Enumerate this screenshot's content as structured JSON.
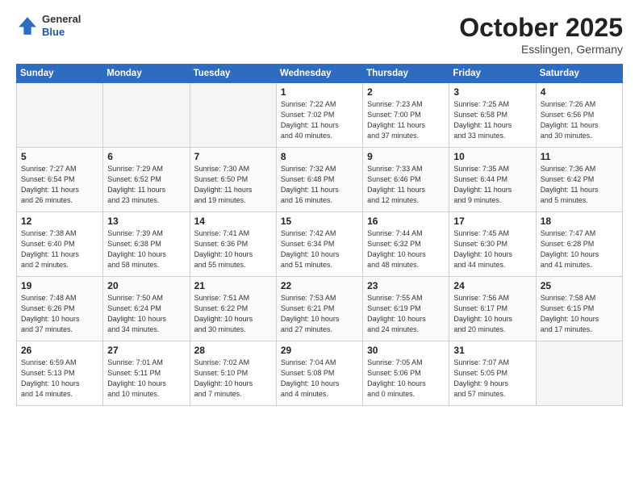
{
  "header": {
    "logo_general": "General",
    "logo_blue": "Blue",
    "month_title": "October 2025",
    "location": "Esslingen, Germany"
  },
  "calendar": {
    "days_of_week": [
      "Sunday",
      "Monday",
      "Tuesday",
      "Wednesday",
      "Thursday",
      "Friday",
      "Saturday"
    ],
    "weeks": [
      [
        {
          "day": "",
          "info": ""
        },
        {
          "day": "",
          "info": ""
        },
        {
          "day": "",
          "info": ""
        },
        {
          "day": "1",
          "info": "Sunrise: 7:22 AM\nSunset: 7:02 PM\nDaylight: 11 hours\nand 40 minutes."
        },
        {
          "day": "2",
          "info": "Sunrise: 7:23 AM\nSunset: 7:00 PM\nDaylight: 11 hours\nand 37 minutes."
        },
        {
          "day": "3",
          "info": "Sunrise: 7:25 AM\nSunset: 6:58 PM\nDaylight: 11 hours\nand 33 minutes."
        },
        {
          "day": "4",
          "info": "Sunrise: 7:26 AM\nSunset: 6:56 PM\nDaylight: 11 hours\nand 30 minutes."
        }
      ],
      [
        {
          "day": "5",
          "info": "Sunrise: 7:27 AM\nSunset: 6:54 PM\nDaylight: 11 hours\nand 26 minutes."
        },
        {
          "day": "6",
          "info": "Sunrise: 7:29 AM\nSunset: 6:52 PM\nDaylight: 11 hours\nand 23 minutes."
        },
        {
          "day": "7",
          "info": "Sunrise: 7:30 AM\nSunset: 6:50 PM\nDaylight: 11 hours\nand 19 minutes."
        },
        {
          "day": "8",
          "info": "Sunrise: 7:32 AM\nSunset: 6:48 PM\nDaylight: 11 hours\nand 16 minutes."
        },
        {
          "day": "9",
          "info": "Sunrise: 7:33 AM\nSunset: 6:46 PM\nDaylight: 11 hours\nand 12 minutes."
        },
        {
          "day": "10",
          "info": "Sunrise: 7:35 AM\nSunset: 6:44 PM\nDaylight: 11 hours\nand 9 minutes."
        },
        {
          "day": "11",
          "info": "Sunrise: 7:36 AM\nSunset: 6:42 PM\nDaylight: 11 hours\nand 5 minutes."
        }
      ],
      [
        {
          "day": "12",
          "info": "Sunrise: 7:38 AM\nSunset: 6:40 PM\nDaylight: 11 hours\nand 2 minutes."
        },
        {
          "day": "13",
          "info": "Sunrise: 7:39 AM\nSunset: 6:38 PM\nDaylight: 10 hours\nand 58 minutes."
        },
        {
          "day": "14",
          "info": "Sunrise: 7:41 AM\nSunset: 6:36 PM\nDaylight: 10 hours\nand 55 minutes."
        },
        {
          "day": "15",
          "info": "Sunrise: 7:42 AM\nSunset: 6:34 PM\nDaylight: 10 hours\nand 51 minutes."
        },
        {
          "day": "16",
          "info": "Sunrise: 7:44 AM\nSunset: 6:32 PM\nDaylight: 10 hours\nand 48 minutes."
        },
        {
          "day": "17",
          "info": "Sunrise: 7:45 AM\nSunset: 6:30 PM\nDaylight: 10 hours\nand 44 minutes."
        },
        {
          "day": "18",
          "info": "Sunrise: 7:47 AM\nSunset: 6:28 PM\nDaylight: 10 hours\nand 41 minutes."
        }
      ],
      [
        {
          "day": "19",
          "info": "Sunrise: 7:48 AM\nSunset: 6:26 PM\nDaylight: 10 hours\nand 37 minutes."
        },
        {
          "day": "20",
          "info": "Sunrise: 7:50 AM\nSunset: 6:24 PM\nDaylight: 10 hours\nand 34 minutes."
        },
        {
          "day": "21",
          "info": "Sunrise: 7:51 AM\nSunset: 6:22 PM\nDaylight: 10 hours\nand 30 minutes."
        },
        {
          "day": "22",
          "info": "Sunrise: 7:53 AM\nSunset: 6:21 PM\nDaylight: 10 hours\nand 27 minutes."
        },
        {
          "day": "23",
          "info": "Sunrise: 7:55 AM\nSunset: 6:19 PM\nDaylight: 10 hours\nand 24 minutes."
        },
        {
          "day": "24",
          "info": "Sunrise: 7:56 AM\nSunset: 6:17 PM\nDaylight: 10 hours\nand 20 minutes."
        },
        {
          "day": "25",
          "info": "Sunrise: 7:58 AM\nSunset: 6:15 PM\nDaylight: 10 hours\nand 17 minutes."
        }
      ],
      [
        {
          "day": "26",
          "info": "Sunrise: 6:59 AM\nSunset: 5:13 PM\nDaylight: 10 hours\nand 14 minutes."
        },
        {
          "day": "27",
          "info": "Sunrise: 7:01 AM\nSunset: 5:11 PM\nDaylight: 10 hours\nand 10 minutes."
        },
        {
          "day": "28",
          "info": "Sunrise: 7:02 AM\nSunset: 5:10 PM\nDaylight: 10 hours\nand 7 minutes."
        },
        {
          "day": "29",
          "info": "Sunrise: 7:04 AM\nSunset: 5:08 PM\nDaylight: 10 hours\nand 4 minutes."
        },
        {
          "day": "30",
          "info": "Sunrise: 7:05 AM\nSunset: 5:06 PM\nDaylight: 10 hours\nand 0 minutes."
        },
        {
          "day": "31",
          "info": "Sunrise: 7:07 AM\nSunset: 5:05 PM\nDaylight: 9 hours\nand 57 minutes."
        },
        {
          "day": "",
          "info": ""
        }
      ]
    ]
  }
}
